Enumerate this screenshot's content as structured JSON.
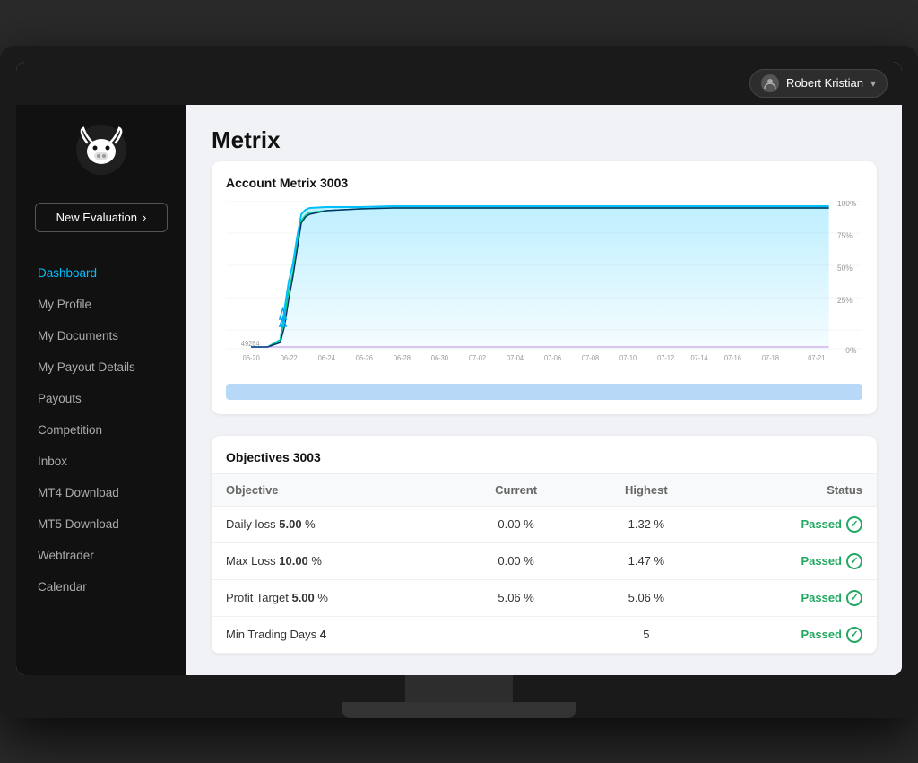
{
  "topbar": {
    "username": "Robert Kristian",
    "chevron": "▾"
  },
  "sidebar": {
    "logo_alt": "Bull logo",
    "new_eval_label": "New Evaluation",
    "new_eval_arrow": "›",
    "nav_items": [
      {
        "label": "Dashboard",
        "active": true,
        "id": "dashboard"
      },
      {
        "label": "My Profile",
        "active": false,
        "id": "profile"
      },
      {
        "label": "My Documents",
        "active": false,
        "id": "documents"
      },
      {
        "label": "My Payout Details",
        "active": false,
        "id": "payout-details"
      },
      {
        "label": "Payouts",
        "active": false,
        "id": "payouts"
      },
      {
        "label": "Competition",
        "active": false,
        "id": "competition"
      },
      {
        "label": "Inbox",
        "active": false,
        "id": "inbox"
      },
      {
        "label": "MT4 Download",
        "active": false,
        "id": "mt4-download"
      },
      {
        "label": "MT5 Download",
        "active": false,
        "id": "mt5-download"
      },
      {
        "label": "Webtrader",
        "active": false,
        "id": "webtrader"
      },
      {
        "label": "Calendar",
        "active": false,
        "id": "calendar"
      }
    ]
  },
  "main": {
    "page_title": "Metrix",
    "chart_section_title": "Account Metrix 3003",
    "chart_dates": [
      "06-20",
      "06-22",
      "06-24",
      "06-26",
      "06-28",
      "06-30",
      "07-02",
      "07-04",
      "07-06",
      "07-08",
      "07-10",
      "07-12",
      "07-14",
      "07-16",
      "07-18",
      "07-21"
    ],
    "chart_y_labels": [
      "100%",
      "75%",
      "50%",
      "25%",
      "0%"
    ],
    "chart_bottom_label": "49264",
    "objectives_section_title": "Objectives 3003",
    "objectives_table": {
      "headers": [
        "Objective",
        "Current",
        "Highest",
        "Status"
      ],
      "rows": [
        {
          "objective": "Daily loss",
          "value": "5.00",
          "unit": "%",
          "current": "0.00 %",
          "highest": "1.32 %",
          "status": "Passed"
        },
        {
          "objective": "Max Loss",
          "value": "10.00",
          "unit": "%",
          "current": "0.00 %",
          "highest": "1.47 %",
          "status": "Passed"
        },
        {
          "objective": "Profit Target",
          "value": "5.00",
          "unit": "%",
          "current": "5.06 %",
          "highest": "5.06 %",
          "status": "Passed"
        },
        {
          "objective": "Min Trading Days",
          "value": "4",
          "unit": "",
          "current": "",
          "highest": "5",
          "status": "Passed"
        }
      ]
    }
  }
}
